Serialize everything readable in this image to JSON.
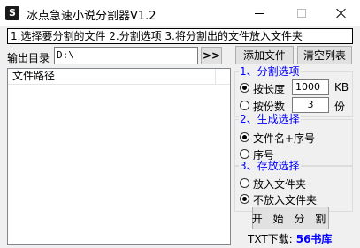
{
  "window": {
    "app_icon_glyph": "S",
    "title": "冰点急速小说分割器V1.2"
  },
  "hint": "1.选择要分割的文件 2.分割选项 3.将分割出的文件放入文件夹",
  "output": {
    "label": "输出目录",
    "value": "D:\\",
    "browse_label": ">>"
  },
  "buttons": {
    "add_file": "添加文件",
    "clear_list": "清空列表",
    "split": "开 始 分 割"
  },
  "file_list": {
    "column_header": "文件路径",
    "rows": []
  },
  "split_options": {
    "title": "1、分割选项",
    "by_length_label": "按长度",
    "by_length_value": "1000",
    "by_length_unit": "KB",
    "by_length_selected": true,
    "by_count_label": "按份数",
    "by_count_value": "3",
    "by_count_unit": "份",
    "by_count_selected": false
  },
  "naming": {
    "title": "2、生成选择",
    "option1": "文件名+序号",
    "option1_selected": true,
    "option2": "序号",
    "option2_selected": false
  },
  "storage": {
    "title": "3、存放选择",
    "option1": "放入文件夹",
    "option1_selected": false,
    "option2": "不放入文件夹",
    "option2_selected": true
  },
  "footer": {
    "download_label": "TXT下载:",
    "download_link": "56书库"
  },
  "colors": {
    "group_title": "#0000ff",
    "link": "#0000ff",
    "client_bg": "#f0f0f0"
  }
}
